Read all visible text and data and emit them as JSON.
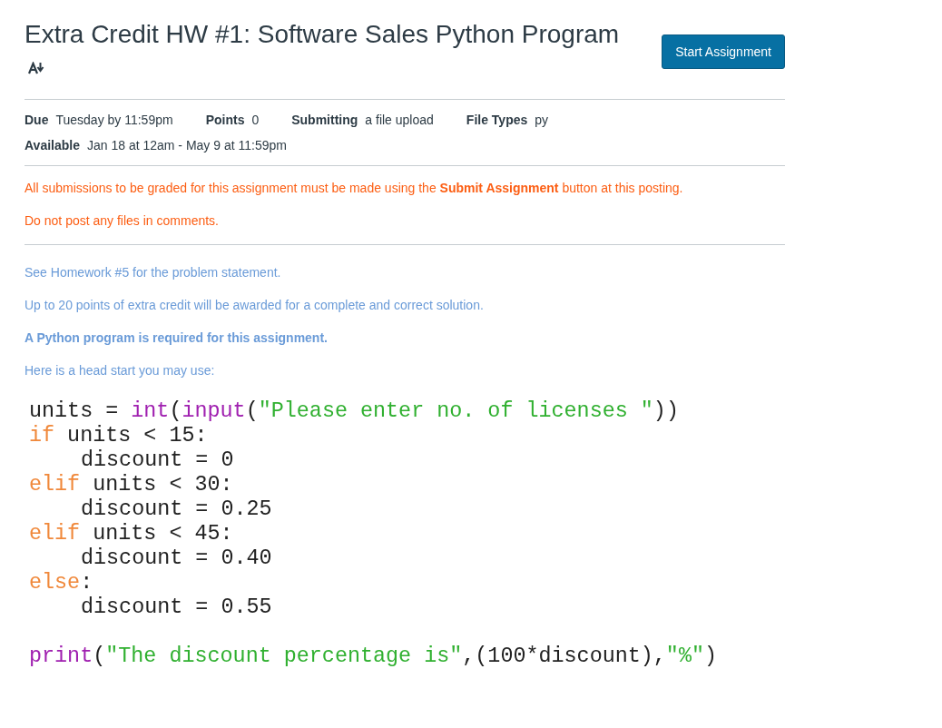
{
  "title": "Extra Credit HW #1: Software Sales Python Program",
  "start_button": "Start Assignment",
  "details": [
    {
      "label": "Due",
      "value": "Tuesday by 11:59pm"
    },
    {
      "label": "Points",
      "value": "0"
    },
    {
      "label": "Submitting",
      "value": "a file upload"
    },
    {
      "label": "File Types",
      "value": "py"
    },
    {
      "label": "Available",
      "value": "Jan 18 at 12am - May 9 at 11:59pm"
    }
  ],
  "notices": [
    "All submissions to be graded for this assignment must be made using the **Submit Assignment** button at this posting.",
    "Do not post any files in comments."
  ],
  "paragraphs": [
    {
      "text": "See Homework #5 for the problem statement.",
      "bold": false
    },
    {
      "text": "Up to 20 points of extra credit will be awarded for a complete and correct solution.",
      "bold": false
    },
    {
      "text": "A Python program is required for this assignment.",
      "bold": true
    },
    {
      "text": "Here is a head start you may use:",
      "bold": false
    }
  ],
  "code_lines": [
    {
      "indented": false,
      "tokens": [
        {
          "kind": "plain",
          "text": "units = "
        },
        {
          "kind": "builtin",
          "text": "int"
        },
        {
          "kind": "plain",
          "text": "("
        },
        {
          "kind": "builtin",
          "text": "input"
        },
        {
          "kind": "plain",
          "text": "("
        },
        {
          "kind": "string",
          "text": "\"Please enter no. of licenses \""
        },
        {
          "kind": "plain",
          "text": "))"
        }
      ]
    },
    {
      "indented": false,
      "tokens": [
        {
          "kind": "keyword",
          "text": "if"
        },
        {
          "kind": "plain",
          "text": " units < 15:"
        }
      ]
    },
    {
      "indented": true,
      "tokens": [
        {
          "kind": "plain",
          "text": "discount = 0"
        }
      ]
    },
    {
      "indented": false,
      "tokens": [
        {
          "kind": "keyword",
          "text": "elif"
        },
        {
          "kind": "plain",
          "text": " units < 30:"
        }
      ]
    },
    {
      "indented": true,
      "tokens": [
        {
          "kind": "plain",
          "text": "discount = 0.25"
        }
      ]
    },
    {
      "indented": false,
      "tokens": [
        {
          "kind": "keyword",
          "text": "elif"
        },
        {
          "kind": "plain",
          "text": " units < 45:"
        }
      ]
    },
    {
      "indented": true,
      "tokens": [
        {
          "kind": "plain",
          "text": "discount = 0.40"
        }
      ]
    },
    {
      "indented": false,
      "tokens": [
        {
          "kind": "keyword",
          "text": "else"
        },
        {
          "kind": "plain",
          "text": ":"
        }
      ]
    },
    {
      "indented": true,
      "tokens": [
        {
          "kind": "plain",
          "text": "discount = 0.55"
        }
      ]
    },
    {
      "kind": "blank"
    },
    {
      "indented": false,
      "tokens": [
        {
          "kind": "builtin",
          "text": "print"
        },
        {
          "kind": "plain",
          "text": "("
        },
        {
          "kind": "string",
          "text": "\"The discount percentage is\""
        },
        {
          "kind": "plain",
          "text": ",(100*discount),"
        },
        {
          "kind": "string",
          "text": "\"%\""
        },
        {
          "kind": "plain",
          "text": ")"
        }
      ]
    }
  ]
}
